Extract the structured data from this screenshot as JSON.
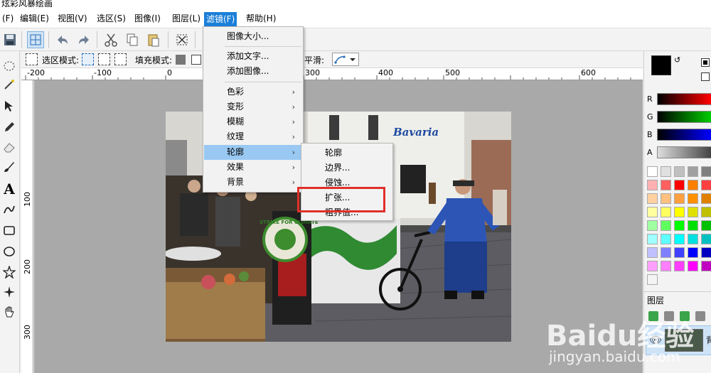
{
  "window": {
    "title": "炫彩风暴绘画"
  },
  "menubar": {
    "items": [
      {
        "label": "(F)"
      },
      {
        "label": "编辑(E)"
      },
      {
        "label": "视图(V)"
      },
      {
        "label": "选区(S)"
      },
      {
        "label": "图像(I)"
      },
      {
        "label": "图层(L)"
      },
      {
        "label": "滤镜(F)"
      },
      {
        "label": "帮助(H)"
      }
    ]
  },
  "optionbar": {
    "select_mode_label": "选区模式:",
    "fill_mode_label": "填充模式:",
    "smooth_label": "平滑:"
  },
  "rulers": {
    "h_labels": [
      "-200",
      "-100",
      "0",
      "300",
      "400",
      "500",
      "600"
    ],
    "v_labels": [
      "100",
      "200",
      "300"
    ]
  },
  "filter_menu": {
    "items": [
      {
        "label": "图像大小..."
      },
      {
        "label": "添加文字..."
      },
      {
        "label": "添加图像..."
      },
      {
        "label": "色彩",
        "arrow": "›"
      },
      {
        "label": "变形",
        "arrow": "›"
      },
      {
        "label": "模糊",
        "arrow": "›"
      },
      {
        "label": "纹理",
        "arrow": "›"
      },
      {
        "label": "轮廓",
        "arrow": "›"
      },
      {
        "label": "效果",
        "arrow": "›"
      },
      {
        "label": "背景",
        "arrow": "›"
      }
    ]
  },
  "outline_submenu": {
    "items": [
      {
        "label": "轮廓"
      },
      {
        "label": "边界..."
      },
      {
        "label": "侵蚀..."
      },
      {
        "label": "扩张..."
      },
      {
        "label": "粗界值..."
      }
    ]
  },
  "color_panel": {
    "labels": {
      "r": "R",
      "g": "G",
      "b": "B",
      "a": "A"
    },
    "swap_glyph": "↺",
    "primary_color": "#000000",
    "secondary_color": "#ffffff"
  },
  "layers_panel": {
    "title": "图层",
    "layer_name": "背"
  },
  "photo": {
    "sign_text": "Bavaria",
    "badge_text": "STRIKE FOR CLIMATE"
  },
  "watermark": {
    "main": "Baidu经验",
    "sub": "jingyan.baidu.com"
  }
}
